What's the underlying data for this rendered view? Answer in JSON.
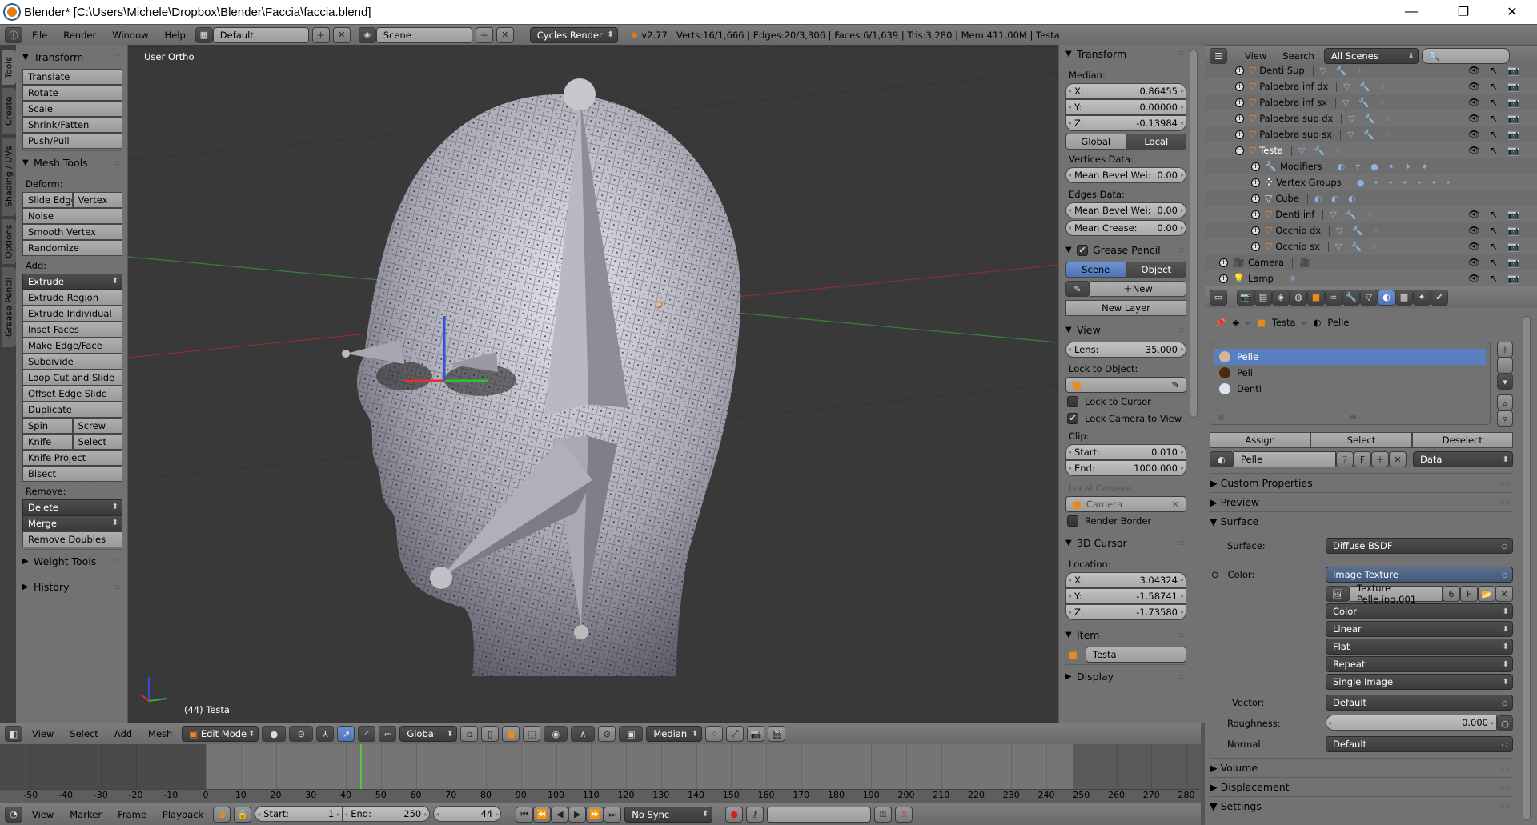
{
  "window": {
    "title": "Blender* [C:\\Users\\Michele\\Dropbox\\Blender\\Faccia\\faccia.blend]",
    "minimize": "—",
    "maximize": "❐",
    "close": "✕"
  },
  "info_header": {
    "menus": [
      "File",
      "Render",
      "Window",
      "Help"
    ],
    "screen_layout": "Default",
    "scene": "Scene",
    "render_engine": "Cycles Render",
    "stats": "v2.77 | Verts:16/1,666 | Edges:20/3,306 | Faces:6/1,639 | Tris:3,280 | Mem:411.00M | Testa"
  },
  "toolshelf": {
    "tabs": [
      {
        "label": "Tools",
        "active": true
      },
      {
        "label": "Create"
      },
      {
        "label": "Shading / UVs"
      },
      {
        "label": "Options"
      },
      {
        "label": "Grease Pencil"
      }
    ],
    "rows": [
      {
        "t": "header",
        "label": "Transform",
        "open": true
      },
      {
        "t": "btn",
        "label": "Translate"
      },
      {
        "t": "btn",
        "label": "Rotate"
      },
      {
        "t": "btn",
        "label": "Scale"
      },
      {
        "t": "btn",
        "label": "Shrink/Fatten"
      },
      {
        "t": "btn",
        "label": "Push/Pull"
      },
      {
        "t": "header",
        "label": "Mesh Tools",
        "open": true
      },
      {
        "t": "label",
        "label": "Deform:"
      },
      {
        "t": "btn2",
        "labels": [
          "Slide Edge",
          "Vertex"
        ]
      },
      {
        "t": "btn",
        "label": "Noise"
      },
      {
        "t": "btn",
        "label": "Smooth Vertex"
      },
      {
        "t": "btn",
        "label": "Randomize"
      },
      {
        "t": "label",
        "label": "Add:"
      },
      {
        "t": "menu",
        "label": "Extrude"
      },
      {
        "t": "btn",
        "label": "Extrude Region"
      },
      {
        "t": "btn",
        "label": "Extrude Individual"
      },
      {
        "t": "btn",
        "label": "Inset Faces"
      },
      {
        "t": "btn",
        "label": "Make Edge/Face"
      },
      {
        "t": "btn",
        "label": "Subdivide"
      },
      {
        "t": "btn",
        "label": "Loop Cut and Slide"
      },
      {
        "t": "btn",
        "label": "Offset Edge Slide"
      },
      {
        "t": "btn",
        "label": "Duplicate"
      },
      {
        "t": "btn2",
        "labels": [
          "Spin",
          "Screw"
        ]
      },
      {
        "t": "btn2",
        "labels": [
          "Knife",
          "Select"
        ]
      },
      {
        "t": "btn",
        "label": "Knife Project"
      },
      {
        "t": "btn",
        "label": "Bisect"
      },
      {
        "t": "label",
        "label": "Remove:"
      },
      {
        "t": "menu",
        "label": "Delete"
      },
      {
        "t": "menu",
        "label": "Merge"
      },
      {
        "t": "btn",
        "label": "Remove Doubles"
      },
      {
        "t": "header",
        "label": "Weight Tools",
        "open": false
      },
      {
        "t": "header",
        "label": "History",
        "open": false
      }
    ]
  },
  "viewport": {
    "view_name": "User Ortho",
    "object_info": "(44) Testa"
  },
  "npanel": {
    "rows": [
      {
        "t": "header",
        "label": "Transform",
        "open": true
      },
      {
        "t": "label",
        "label": "Median:"
      },
      {
        "t": "num",
        "label": "X:",
        "value": "0.86455",
        "pos": "top"
      },
      {
        "t": "num",
        "label": "Y:",
        "value": "0.00000"
      },
      {
        "t": "num",
        "label": "Z:",
        "value": "-0.13984",
        "pos": "bottom"
      },
      {
        "t": "seg",
        "labels": [
          "Global",
          "Local"
        ],
        "active": 1
      },
      {
        "t": "label",
        "label": "Vertices Data:"
      },
      {
        "t": "num",
        "label": "Mean Bevel Wei:",
        "value": "0.00",
        "pos": "single"
      },
      {
        "t": "label",
        "label": "Edges Data:"
      },
      {
        "t": "num",
        "label": "Mean Bevel Wei:",
        "value": "0.00",
        "pos": "single"
      },
      {
        "t": "num",
        "label": "Mean Crease:",
        "value": "0.00",
        "pos": "single"
      },
      {
        "t": "header",
        "label": "Grease Pencil",
        "open": true,
        "checked": true
      },
      {
        "t": "segblue",
        "labels": [
          "Scene",
          "Object"
        ],
        "active": 0
      },
      {
        "t": "new",
        "label": "New"
      },
      {
        "t": "btnc",
        "label": "New Layer"
      },
      {
        "t": "header",
        "label": "View",
        "open": true
      },
      {
        "t": "num",
        "label": "Lens:",
        "value": "35.000",
        "pos": "single"
      },
      {
        "t": "label",
        "label": "Lock to Object:"
      },
      {
        "t": "objfield",
        "value": ""
      },
      {
        "t": "check",
        "label": "Lock to Cursor",
        "checked": false
      },
      {
        "t": "check",
        "label": "Lock Camera to View",
        "checked": true
      },
      {
        "t": "label",
        "label": "Clip:"
      },
      {
        "t": "num",
        "label": "Start:",
        "value": "0.010",
        "pos": "top"
      },
      {
        "t": "num",
        "label": "End:",
        "value": "1000.000",
        "pos": "bottom"
      },
      {
        "t": "label",
        "label": "Local Camera:",
        "disabled": true
      },
      {
        "t": "objfield",
        "value": "Camera",
        "disabled": true
      },
      {
        "t": "check",
        "label": "Render Border",
        "checked": false
      },
      {
        "t": "header",
        "label": "3D Cursor",
        "open": true
      },
      {
        "t": "label",
        "label": "Location:"
      },
      {
        "t": "num",
        "label": "X:",
        "value": "3.04324",
        "pos": "top"
      },
      {
        "t": "num",
        "label": "Y:",
        "value": "-1.58741"
      },
      {
        "t": "num",
        "label": "Z:",
        "value": "-1.73580",
        "pos": "bottom"
      },
      {
        "t": "header",
        "label": "Item",
        "open": true
      },
      {
        "t": "item",
        "value": "Testa"
      },
      {
        "t": "header",
        "label": "Display",
        "open": false
      }
    ]
  },
  "outliner": {
    "menus": [
      "View",
      "Search"
    ],
    "filter": "All Scenes",
    "search_placeholder": "",
    "rows": [
      {
        "name": "Denti Sup",
        "depth": 2,
        "kind": "mesh",
        "expand": "+",
        "restrict": true
      },
      {
        "name": "Palpebra inf dx",
        "depth": 2,
        "kind": "mesh",
        "expand": "+",
        "restrict": true
      },
      {
        "name": "Palpebra inf sx",
        "depth": 2,
        "kind": "mesh",
        "expand": "+",
        "restrict": true
      },
      {
        "name": "Palpebra sup dx",
        "depth": 2,
        "kind": "mesh",
        "expand": "+",
        "restrict": true
      },
      {
        "name": "Palpebra sup sx",
        "depth": 2,
        "kind": "mesh",
        "expand": "+",
        "restrict": true
      },
      {
        "name": "Testa",
        "depth": 2,
        "kind": "mesh",
        "expand": "−",
        "restrict": true,
        "active": true
      },
      {
        "name": "Modifiers",
        "depth": 3,
        "kind": "modifiers",
        "expand": "+"
      },
      {
        "name": "Vertex Groups",
        "depth": 3,
        "kind": "vgroups",
        "expand": "+"
      },
      {
        "name": "Cube",
        "depth": 3,
        "kind": "meshdata",
        "expand": "+"
      },
      {
        "name": "Denti inf",
        "depth": 3,
        "kind": "mesh",
        "expand": "+",
        "restrict": true
      },
      {
        "name": "Occhio dx",
        "depth": 3,
        "kind": "mesh",
        "expand": "+",
        "restrict": true
      },
      {
        "name": "Occhio sx",
        "depth": 3,
        "kind": "mesh",
        "expand": "+",
        "restrict": true
      },
      {
        "name": "Camera",
        "depth": 1,
        "kind": "camera",
        "expand": "+",
        "restrict": true
      },
      {
        "name": "Lamp",
        "depth": 1,
        "kind": "lamp",
        "expand": "+",
        "restrict": true
      }
    ]
  },
  "properties": {
    "breadcrumb": [
      "Testa",
      "Pelle"
    ],
    "materials": [
      {
        "name": "Pelle",
        "color": "#d4b49a",
        "selected": true
      },
      {
        "name": "Peli",
        "color": "#4a2a10"
      },
      {
        "name": "Denti",
        "color": "#dde4f0"
      }
    ],
    "slot_buttons": [
      "Assign",
      "Select",
      "Deselect"
    ],
    "material_name": "Pelle",
    "users": "7",
    "fake": "F",
    "link": "Data",
    "sections": {
      "custom": "Custom Properties",
      "preview": "Preview",
      "surface": "Surface",
      "volume": "Volume",
      "displacement": "Displacement",
      "settings": "Settings"
    },
    "surface": {
      "surface_label": "Surface:",
      "surface_value": "Diffuse BSDF",
      "color_label": "Color:",
      "color_value": "Image Texture",
      "image": "Texture Pelle.jpg.001",
      "image_users": "6",
      "image_fake": "F",
      "dropdowns": [
        "Color",
        "Linear",
        "Flat",
        "Repeat",
        "Single Image"
      ],
      "vector_label": "Vector:",
      "vector_value": "Default",
      "roughness_label": "Roughness:",
      "roughness_value": "0.000",
      "roughness_fraction": 0.0,
      "normal_label": "Normal:",
      "normal_value": "Default"
    }
  },
  "view3d_header": {
    "menus": [
      "View",
      "Select",
      "Add",
      "Mesh"
    ],
    "mode": "Edit Mode",
    "orientation": "Global",
    "pivot": "Median"
  },
  "timeline": {
    "ticks": [
      -50,
      -40,
      -30,
      -20,
      -10,
      0,
      10,
      20,
      30,
      40,
      50,
      60,
      70,
      80,
      90,
      100,
      110,
      120,
      130,
      140,
      150,
      160,
      170,
      180,
      190,
      200,
      210,
      220,
      230,
      240,
      250,
      260,
      270,
      280
    ],
    "current_frame": 44,
    "start": 1,
    "end": 250,
    "menus": [
      "View",
      "Marker",
      "Frame",
      "Playback"
    ],
    "start_label": "Start:",
    "end_label": "End:",
    "start_value": "1",
    "end_value": "250",
    "frame_value": "44",
    "sync": "No Sync"
  },
  "colors": {
    "accent_blue": "#5680c2",
    "frame_line": "#60c040",
    "object_orange": "#e88a1d"
  }
}
